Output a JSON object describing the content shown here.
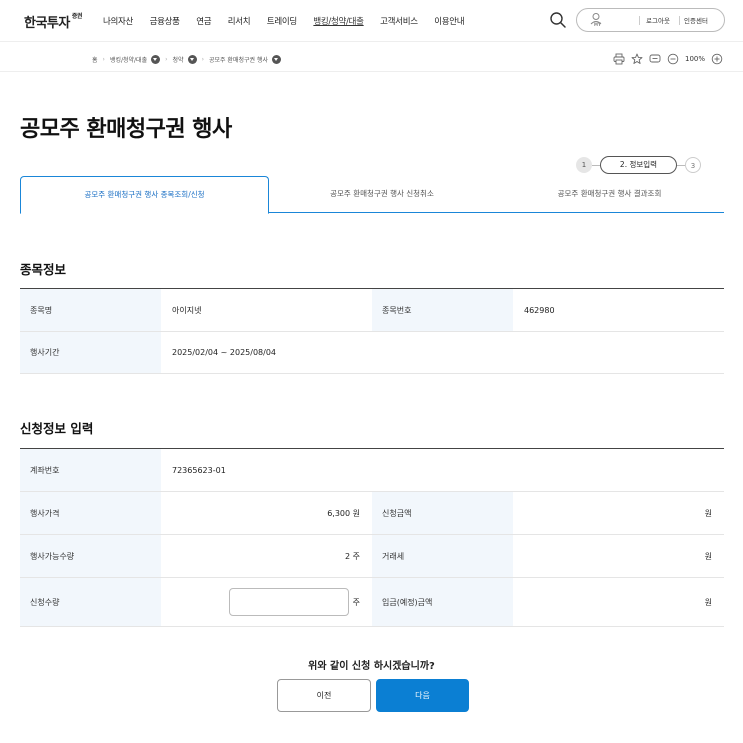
{
  "header": {
    "logo": "한국투자",
    "logo_sup": "증권",
    "menu": [
      "나의자산",
      "금융상품",
      "연금",
      "리서치",
      "트레이딩",
      "뱅킹/청약/대출",
      "고객서비스",
      "이용안내"
    ],
    "active_menu_index": 5,
    "my_label": "MY",
    "login": "로그아웃",
    "cert": "인증센터"
  },
  "breadcrumb": {
    "items": [
      "홈",
      "뱅킹/청약/대출",
      "청약",
      "공모주 환매청구권 행사"
    ],
    "zoom": "100%"
  },
  "page_title": "공모주 환매청구권 행사",
  "steps": {
    "step1": "1",
    "step2": "2. 정보입력",
    "step3": "3"
  },
  "tabs": [
    "공모주 환매청구권 행사 종목조회/신청",
    "공모주 환매청구권 행사 신청취소",
    "공모주 환매청구권 행사 결과조회"
  ],
  "stock_info": {
    "title": "종목정보",
    "name_label": "종목명",
    "name_value": "아이지넷",
    "code_label": "종목번호",
    "code_value": "462980",
    "period_label": "행사기간",
    "period_value": "2025/02/04 ~ 2025/08/04"
  },
  "apply_info": {
    "title": "신청정보 입력",
    "account_label": "계좌번호",
    "account_value": "72365623-01",
    "price_label": "행사가격",
    "price_value": "6,300 원",
    "amount_label": "신청금액",
    "amount_value": "원",
    "avail_label": "행사가능수량",
    "avail_value": "2 주",
    "tax_label": "거래세",
    "tax_value": "원",
    "qty_label": "신청수량",
    "qty_unit": "주",
    "qty_value": "",
    "deposit_label": "입금(예정)금액",
    "deposit_value": "원"
  },
  "confirm": {
    "question": "위와 같이 신청 하시겠습니까?",
    "prev": "이전",
    "next": "다음"
  },
  "colors": {
    "accent": "#0b7fd3",
    "tab_active": "#1a6fc4",
    "th_bg": "#f2f7fc"
  }
}
